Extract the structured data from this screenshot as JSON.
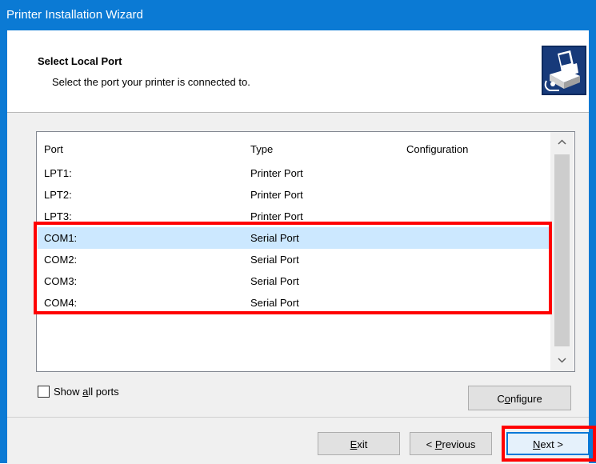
{
  "window": {
    "title": "Printer Installation Wizard"
  },
  "header": {
    "title": "Select Local Port",
    "subtitle": "Select the port your printer is connected to.",
    "icon": "printer-install-icon"
  },
  "ports_table": {
    "columns": [
      "Port",
      "Type",
      "Configuration"
    ],
    "rows": [
      {
        "port": "LPT1:",
        "type": "Printer Port",
        "configuration": "",
        "selected": false
      },
      {
        "port": "LPT2:",
        "type": "Printer Port",
        "configuration": "",
        "selected": false
      },
      {
        "port": "LPT3:",
        "type": "Printer Port",
        "configuration": "",
        "selected": false
      },
      {
        "port": "COM1:",
        "type": "Serial Port",
        "configuration": "",
        "selected": true
      },
      {
        "port": "COM2:",
        "type": "Serial Port",
        "configuration": "",
        "selected": false
      },
      {
        "port": "COM3:",
        "type": "Serial Port",
        "configuration": "",
        "selected": false
      },
      {
        "port": "COM4:",
        "type": "Serial Port",
        "configuration": "",
        "selected": false
      }
    ]
  },
  "show_all_ports": {
    "label_pre": "Show ",
    "label_accel": "a",
    "label_post": "ll ports",
    "checked": false
  },
  "buttons": {
    "configure": {
      "pre": "C",
      "accel": "o",
      "post": "nfigure"
    },
    "exit": {
      "pre": "",
      "accel": "E",
      "post": "xit"
    },
    "previous": {
      "pre": "< ",
      "accel": "P",
      "post": "revious"
    },
    "next": {
      "pre": "",
      "accel": "N",
      "post": "ext >"
    }
  },
  "colors": {
    "titlebar": "#0b7ad4",
    "selection": "#cce8ff",
    "annotation": "#ff0000",
    "default_button_border": "#0078d7"
  }
}
